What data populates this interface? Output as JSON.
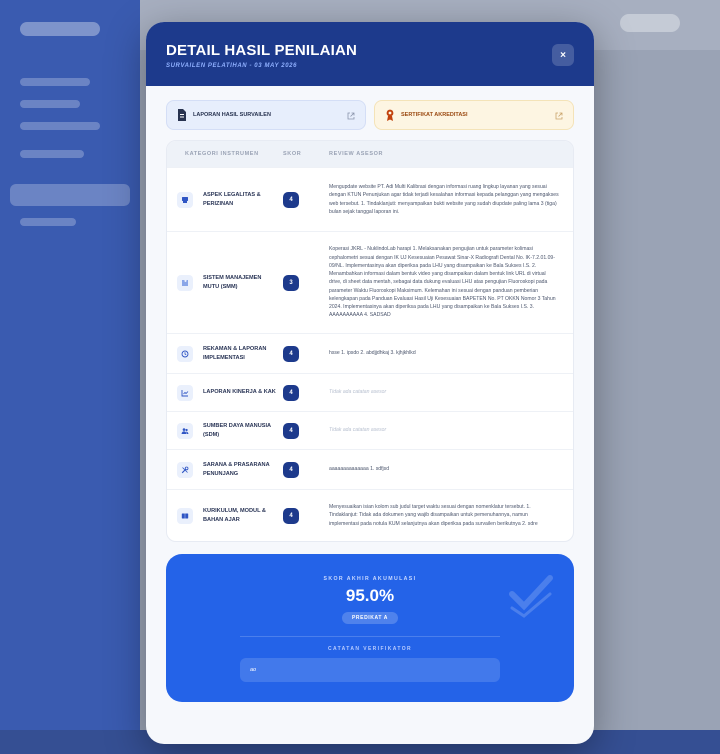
{
  "modal": {
    "title": "DETAIL HASIL PENILAIAN",
    "subtitle": "SURVAILEN PELATIHAN - 03 MAY 2026",
    "close_label": "×"
  },
  "documents": [
    {
      "label": "LAPORAN HASIL SURVAILEN",
      "icon": "document-icon",
      "color": "#283350"
    },
    {
      "label": "SERTIFIKAT AKREDITASI",
      "icon": "certificate-icon",
      "color": "#9b4a12"
    }
  ],
  "table": {
    "headers": {
      "category": "KATEGORI INSTRUMEN",
      "score": "SKOR",
      "review": "REVIEW ASESOR"
    },
    "rows": [
      {
        "icon": "gavel-icon",
        "name": "ASPEK LEGALITAS & PERIZINAN",
        "score": "4",
        "review": "Mengupdate website PT. Adi Multi Kalibrasi dengan informasi ruang lingkup layanan yang sesuai dengan KTUN Penunjukan agar tidak terjadi kesalahan informasi kepada pelanggan yang mengakses web tersebut. 1. Tindaklanjuti: menyampaikan bukti website yang sudah diupdate paling lama 3 (tiga) bulan sejak tanggal laporan ini."
      },
      {
        "icon": "puzzle-icon",
        "name": "SISTEM MANAJEMEN MUTU (SMM)",
        "score": "3",
        "review": "Koperasi JKRL - NuklindoLab harapi 1. Melaksanakan pengujian untuk parameter kolimasi cephalometri sesuai dengan IK UJ Kesesuaian Pesawat Sinar-X Radiografi Dental No. IK-7.2.01.09-09/NL. Implementasinya akan diperiksa pada LHU yang disampaikan ke Bala Sukses I.S. 2. Menambahkan informasi dalam bentuk video yang disampaikan dalam bentuk link URL di virtual drive, di sheet data mentah, sebagai data dukung evaluasi LHU atas pengujian Fluoroskopi pada parameter Waktu Fluoroskopi Maksimum. Kelemahan ini sesuai dengan panduan pemberian kelengkapan pada Panduan Evaluasi Hasil Uji Kesesuaian BAPETEN No. PT OKKN Nomor 3 Tahun 2024. Implementasinya akan diperiksa pada LHU yang disampaikan ke Bala Sukses I.S. 3. AAAAAAAAAA 4. SADSAD"
      },
      {
        "icon": "history-icon",
        "name": "REKAMAN & LAPORAN IMPLEMENTASI",
        "score": "4",
        "review": "hsse 1. ipsdo 2. abdjjdhkaj 3. kjhjkhlkd"
      },
      {
        "icon": "chart-icon",
        "name": "LAPORAN KINERJA & KAK",
        "score": "4",
        "review": "Tidak ada catatan asesor",
        "empty": true
      },
      {
        "icon": "users-icon",
        "name": "SUMBER DAYA MANUSIA (SDM)",
        "score": "4",
        "review": "Tidak ada catatan asesor",
        "empty": true
      },
      {
        "icon": "tools-icon",
        "name": "SARANA & PRASARANA PENUNJANG",
        "score": "4",
        "review": "aaaaaaaaaaaaaa 1. sdfjsd"
      },
      {
        "icon": "book-icon",
        "name": "KURIKULUM, MODUL & BAHAN AJAR",
        "score": "4",
        "review": "Menyesuaikan isian kolom sub judul target waktu sesuai dengan nomenklatur tersebut. 1. Tindaklanjut: Tidak ada dokumen yang wajib disampaikan untuk pemenuhannya, namun implementasi pada notula KUM selanjutnya akan diperiksa pada survailen berikutnya 2. sdre"
      }
    ]
  },
  "summary": {
    "label": "SKOR AKHIR AKUMULASI",
    "score": "95.0%",
    "predicate": "PREDIKAT A",
    "verifier_label": "CATATAN VERIFIKATOR",
    "verifier_note": "ao"
  },
  "colors": {
    "header": "#1d3a8c",
    "summary": "#2463e8",
    "badge": "#1d3a8c"
  }
}
